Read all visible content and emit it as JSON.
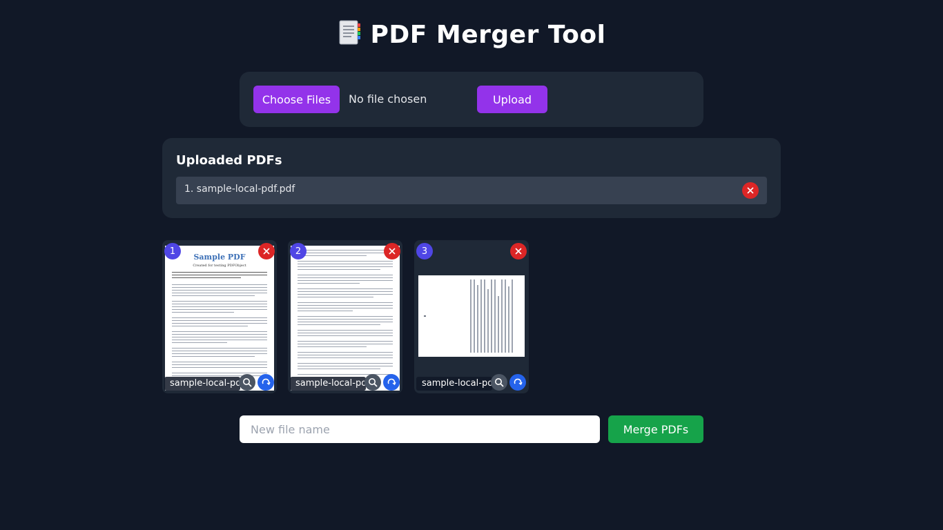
{
  "app": {
    "title": "PDF Merger Tool",
    "title_icon": "document-icon"
  },
  "upload": {
    "choose_label": "Choose Files",
    "file_status": "No file chosen",
    "upload_label": "Upload"
  },
  "uploaded": {
    "heading": "Uploaded PDFs",
    "items": [
      {
        "label": "1. sample-local-pdf.pdf"
      }
    ]
  },
  "pages": [
    {
      "number": "1",
      "caption": "sample-local-pdf.pdf",
      "rotated": false,
      "doc_title": "Sample PDF",
      "doc_subtitle": "Created for testing PDFObject"
    },
    {
      "number": "2",
      "caption": "sample-local-pdf.pdf",
      "rotated": false
    },
    {
      "number": "3",
      "caption": "sample-local-pdf.pdf",
      "rotated": true
    }
  ],
  "merge": {
    "placeholder": "New file name",
    "button_label": "Merge PDFs"
  },
  "colors": {
    "background": "#111827",
    "card": "#1f2937",
    "primary": "#9333ea",
    "danger": "#dc2626",
    "success": "#16a34a",
    "badge": "#4f46e5",
    "rotate": "#2563eb"
  }
}
